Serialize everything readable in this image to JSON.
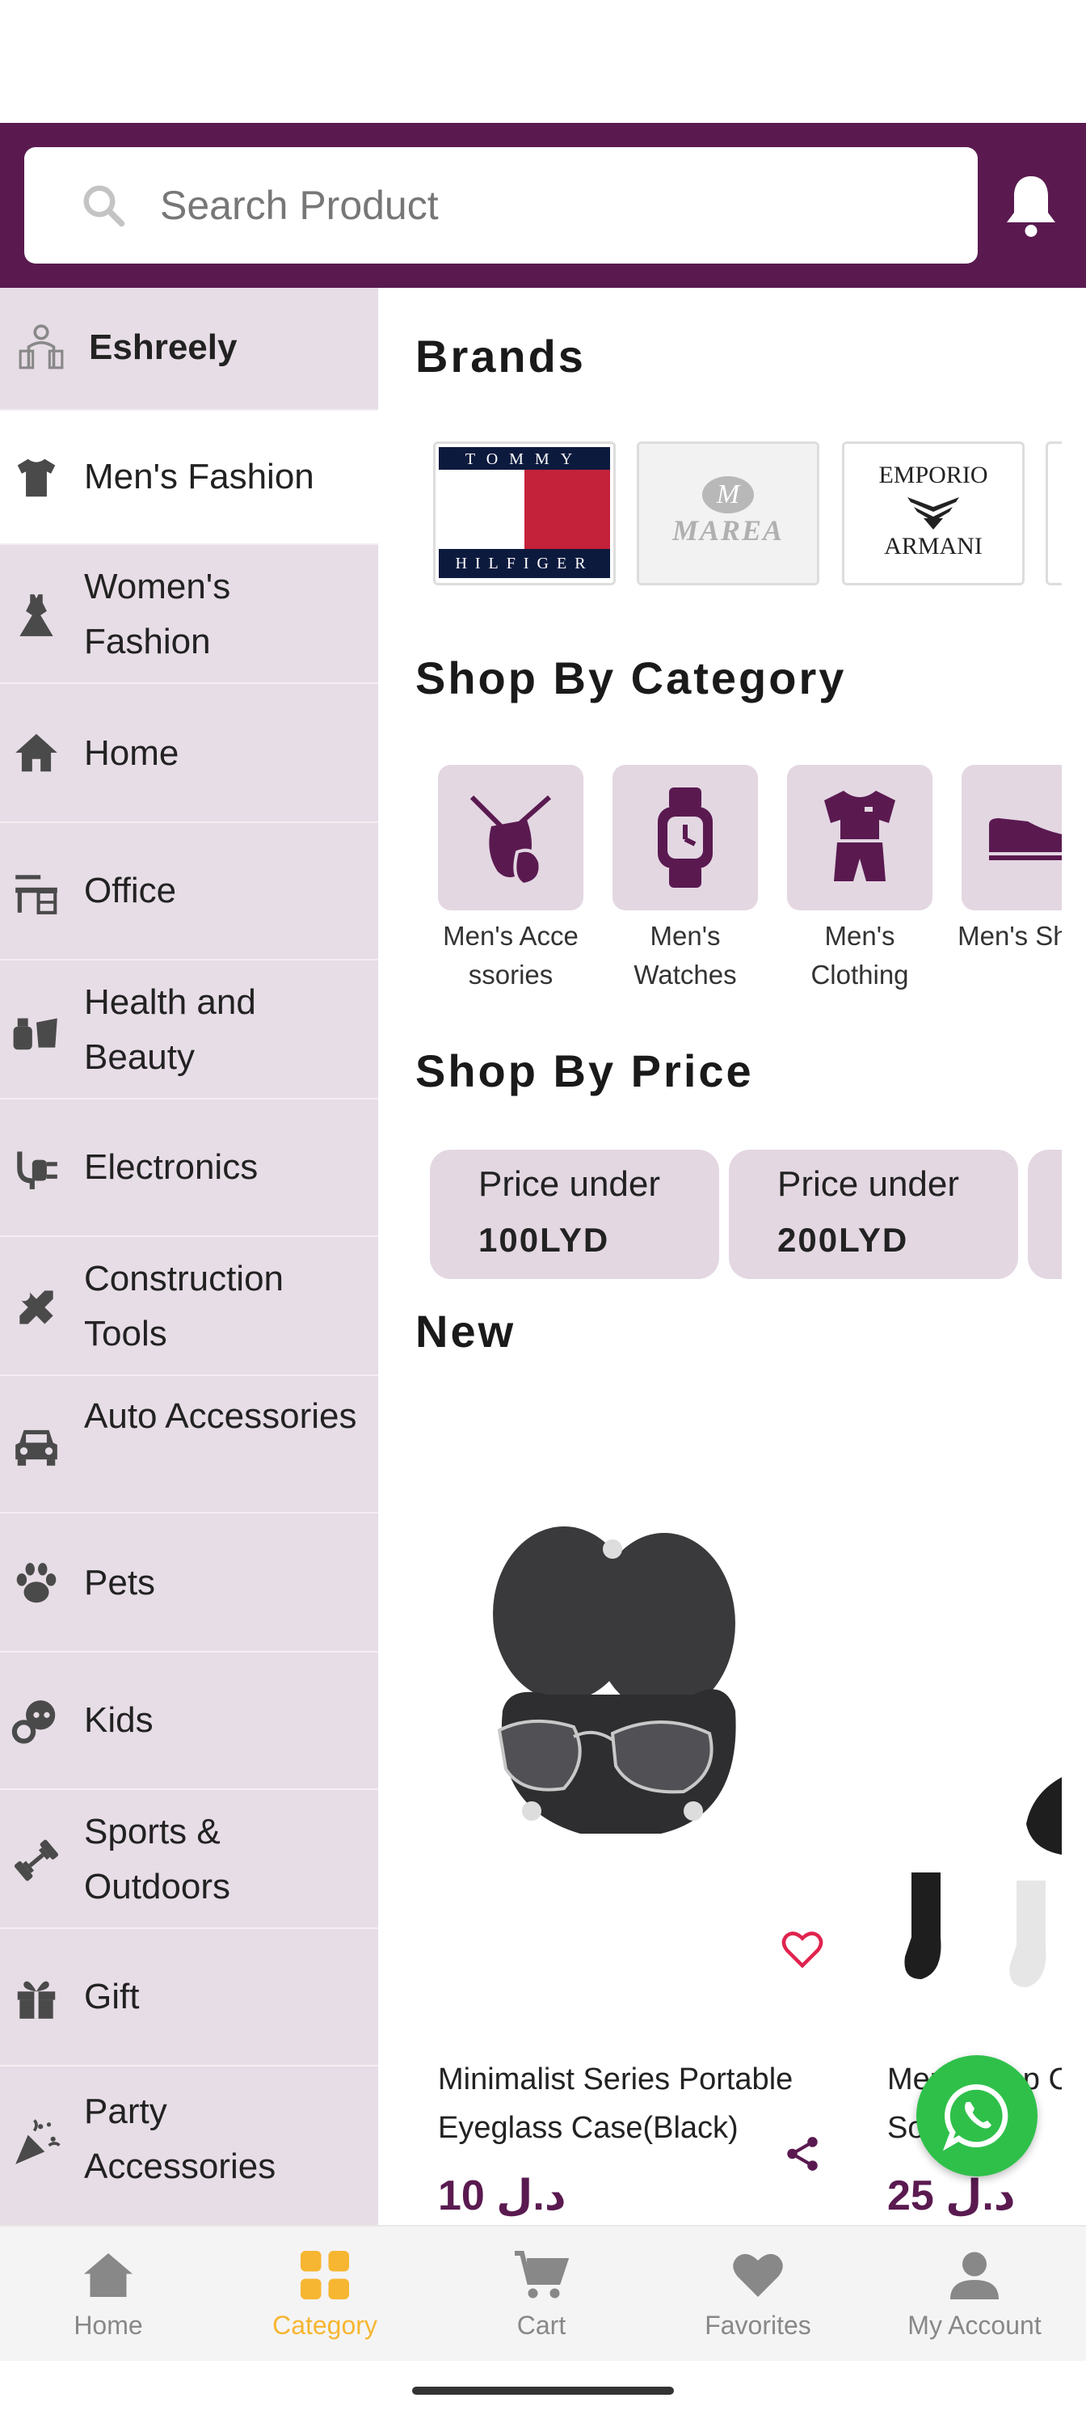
{
  "search": {
    "placeholder": "Search Product"
  },
  "sidebar": {
    "items": [
      {
        "label": "Eshreely",
        "icon": "shopping-bags-icon"
      },
      {
        "label": "Men's Fashion",
        "icon": "tshirt-icon"
      },
      {
        "label": "Women's Fashion",
        "icon": "dress-icon"
      },
      {
        "label": "Home",
        "icon": "house-icon"
      },
      {
        "label": "Office",
        "icon": "desk-icon"
      },
      {
        "label": "Health and Beauty",
        "icon": "beauty-products-icon"
      },
      {
        "label": "Electronics",
        "icon": "plug-icon"
      },
      {
        "label": "Construction Tools",
        "icon": "tools-icon"
      },
      {
        "label": "Auto Accessories",
        "icon": "car-icon"
      },
      {
        "label": "Pets",
        "icon": "paw-icon"
      },
      {
        "label": "Kids",
        "icon": "baby-icon"
      },
      {
        "label": "Sports & Outdoors",
        "icon": "dumbbell-icon"
      },
      {
        "label": "Gift",
        "icon": "gift-icon"
      },
      {
        "label": "Party Accessories",
        "icon": "party-popper-icon"
      }
    ]
  },
  "main": {
    "brands_title": "Brands",
    "brands": [
      {
        "line1": "TOMMY",
        "line2": "HILFIGER"
      },
      {
        "line1": "MAREA"
      },
      {
        "line1": "EMPORIO",
        "line2": "ARMANI"
      }
    ],
    "category_title": "Shop By Category",
    "categories": [
      {
        "label": "Men's Acce ssories",
        "icon": "accessories-icon"
      },
      {
        "label": "Men's Watches",
        "icon": "watch-icon"
      },
      {
        "label": "Men's Clothing",
        "icon": "clothing-icon"
      },
      {
        "label": "Men's Shoes",
        "icon": "shoe-icon"
      }
    ],
    "price_title": "Shop By Price",
    "price_filters": [
      {
        "line1": "Price under",
        "line2": "100LYD"
      },
      {
        "line1": "Price under",
        "line2": "200LYD"
      }
    ],
    "new_title": "New",
    "products": [
      {
        "name": "Minimalist Series Portable Eyeglass Case(Black)",
        "currency": "د.ل",
        "price": "10"
      },
      {
        "name": "Men's Step Crew Socks",
        "currency": "د.ل",
        "price": "25"
      }
    ]
  },
  "bottom_nav": {
    "items": [
      {
        "label": "Home",
        "icon": "home-icon"
      },
      {
        "label": "Category",
        "icon": "grid-icon",
        "active": true
      },
      {
        "label": "Cart",
        "icon": "cart-icon"
      },
      {
        "label": "Favorites",
        "icon": "heart-icon"
      },
      {
        "label": "My Account",
        "icon": "user-icon"
      }
    ]
  },
  "colors": {
    "brand": "#5a1a50",
    "accent": "#f6b631",
    "sidebar_bg": "#e7dde6",
    "whatsapp": "#2fc04a"
  }
}
